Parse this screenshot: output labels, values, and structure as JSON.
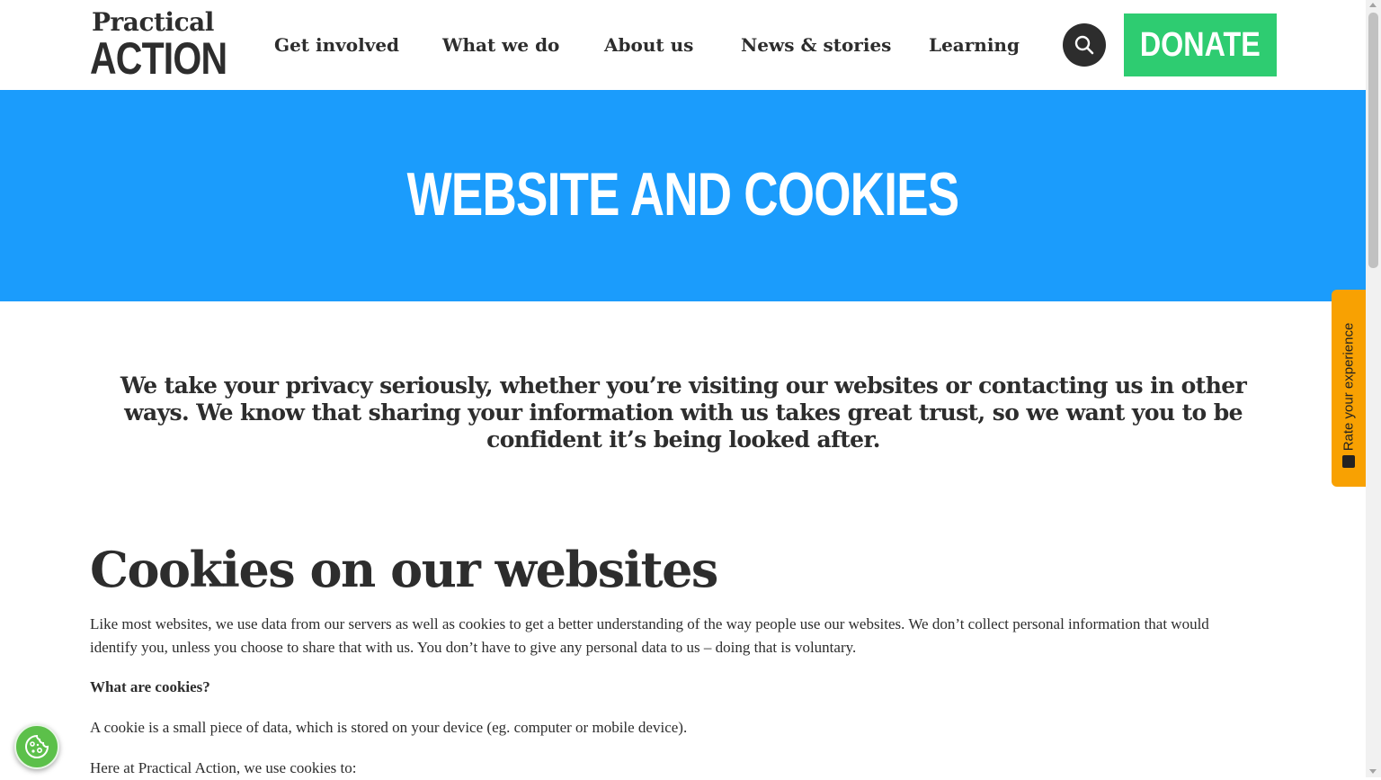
{
  "logo": {
    "line1": "Practical",
    "line2": "ACTION"
  },
  "nav": [
    {
      "label": "Get involved"
    },
    {
      "label": "What we do"
    },
    {
      "label": "About us"
    },
    {
      "label": "News & stories"
    },
    {
      "label": "Learning"
    }
  ],
  "header": {
    "search_icon": "search-icon",
    "donate_label": "DONATE"
  },
  "hero": {
    "title": "WEBSITE AND COOKIES"
  },
  "intro": "We take your privacy seriously, whether you’re visiting our websites or contacting us in other ways. We know that sharing your information with us takes great trust, so we want you to be confident it’s being looked after.",
  "section": {
    "heading": "Cookies on our websites",
    "para1": "Like most websites, we use data from our servers as well as cookies to get a better understanding of the way people use our websites. We don’t collect personal information that would identify you, unless you choose to share that with us. You don’t have to give any personal data to us – doing that is voluntary.",
    "subheading": "What are cookies?",
    "para2": "A cookie is a small piece of data, which is stored on your device (eg. computer or mobile device).",
    "para3": "Here at Practical Action, we use cookies to:"
  },
  "feedback": {
    "label": "Rate your experience",
    "icon": "smiley-icon"
  },
  "cookie_settings": {
    "icon": "cookie-icon"
  },
  "colors": {
    "brand_blue": "#1b9cfc",
    "donate_green": "#2ecc71",
    "feedback_orange": "#f8a102",
    "text_dark": "#2d2d2d"
  }
}
